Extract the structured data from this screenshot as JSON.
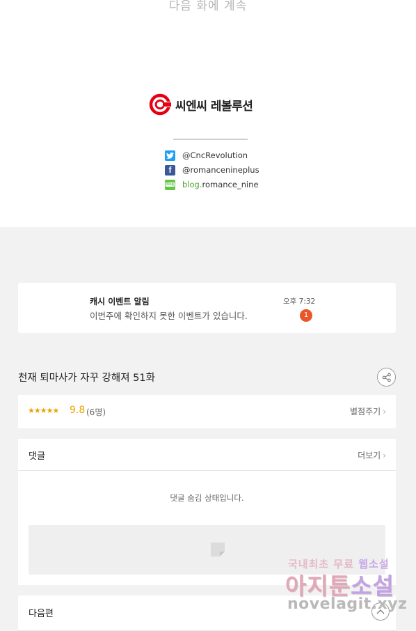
{
  "top": {
    "next_episode_text": "다음 화에 계속",
    "publisher_name": "씨엔씨 레볼루션",
    "social": [
      {
        "prefix": "",
        "text": "@CncRevolution",
        "icon": "twitter-icon"
      },
      {
        "prefix": "",
        "text": "@romancenineplus",
        "icon": "facebook-icon"
      },
      {
        "prefix": "blog.",
        "text": "romance_nine",
        "icon": "blog-icon"
      }
    ]
  },
  "notice": {
    "title": "캐시 이벤트 알림",
    "body": "이번주에 확인하지 못한 이벤트가 있습니다.",
    "time": "오후 7:32",
    "badge": "1"
  },
  "episode": {
    "title": "천재 퇴마사가 자꾸 강해져 51화",
    "share_icon": "share-icon"
  },
  "rating": {
    "stars": "★★★★★",
    "score": "9.8",
    "count": "(6명)",
    "rate_label": "별점주기",
    "chevron": "›"
  },
  "comments": {
    "title": "댓글",
    "more_label": "더보기",
    "chevron": "›",
    "hidden_message": "댓글 숨김 상태입니다."
  },
  "next": {
    "title": "다음편"
  },
  "watermark": {
    "line1_a": "국내최초 무료 ",
    "line1_b": "웹소설",
    "line2_a": "아지툰",
    "line2_b": "소설",
    "line3": "novelagit.xyz"
  },
  "colors": {
    "accent_orange": "#e8a300",
    "badge_red": "#e8562a",
    "twitter": "#1da1f2",
    "facebook": "#3b5998",
    "blog": "#62c548",
    "logo_red": "#e60012"
  }
}
